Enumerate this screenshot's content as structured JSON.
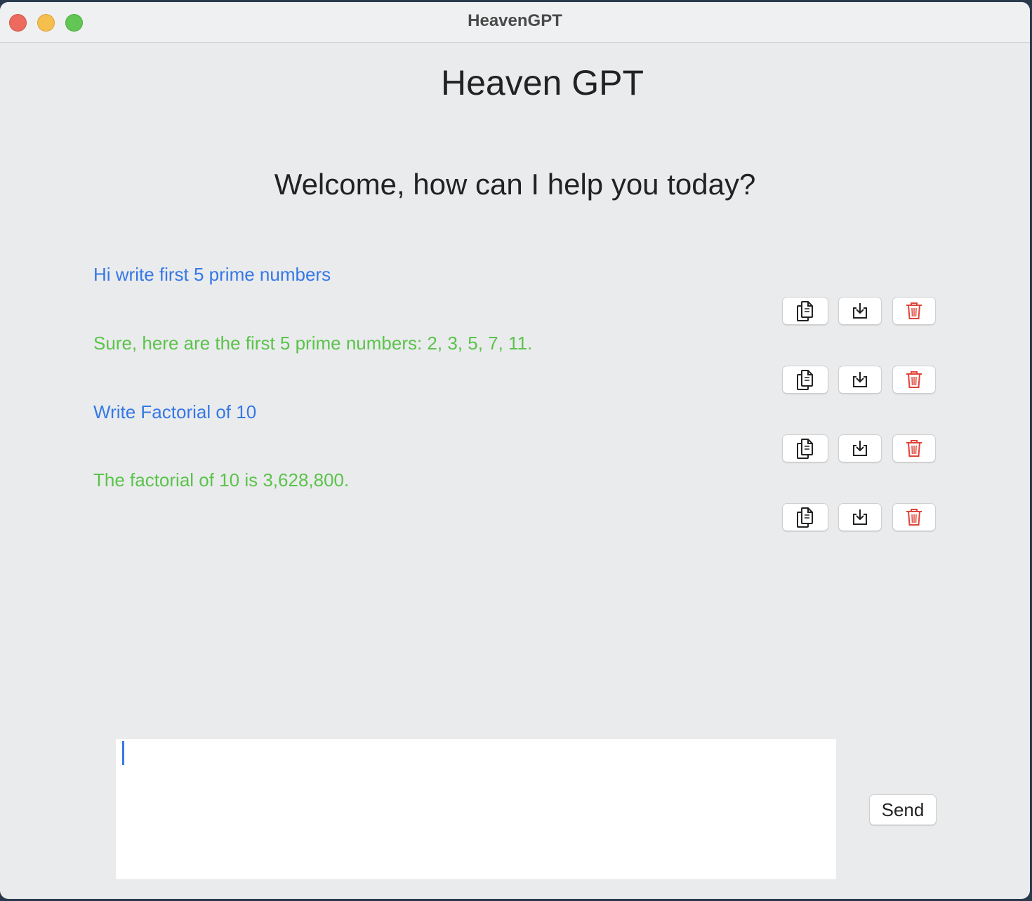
{
  "window": {
    "title": "HeavenGPT"
  },
  "header": {
    "app_title": "Heaven GPT",
    "welcome": "Welcome, how can I help you today?"
  },
  "messages": [
    {
      "role": "user",
      "text": "Hi write first 5 prime numbers"
    },
    {
      "role": "assistant",
      "text": "Sure, here are the first 5 prime numbers: 2, 3, 5, 7, 11."
    },
    {
      "role": "user",
      "text": "Write Factorial of 10"
    },
    {
      "role": "assistant",
      "text": "The factorial of 10 is 3,628,800."
    }
  ],
  "actions": {
    "copy_icon": "copy-icon",
    "save_icon": "download-icon",
    "delete_icon": "trash-icon"
  },
  "composer": {
    "value": "",
    "send_label": "Send"
  },
  "colors": {
    "user_text": "#3578e5",
    "assistant_text": "#5ac34a",
    "delete_icon": "#e0443a"
  }
}
